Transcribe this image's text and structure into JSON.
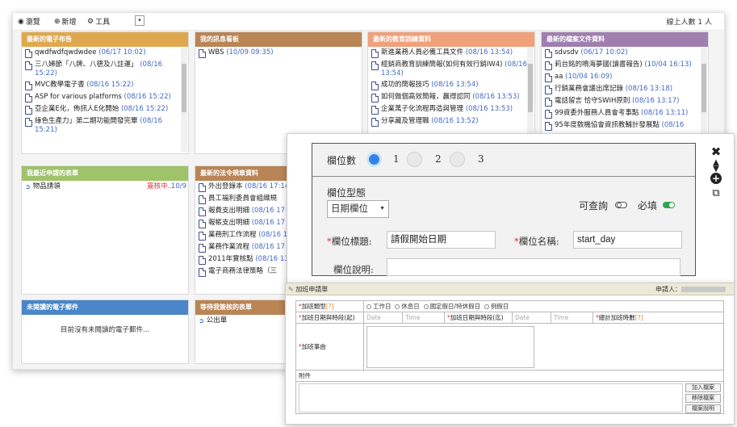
{
  "toolbar": {
    "overview": "瀏覽",
    "add": "新增",
    "tools": "工具",
    "dropdown": "▾",
    "online": "線上人數 1 人"
  },
  "panels": {
    "announcements": {
      "title": "最新的電子布告",
      "color": "#e0a84e",
      "items": [
        {
          "text": "qwdfwdfqwdwdee",
          "date": "(06/17 10:02)"
        },
        {
          "text": "三八婦節「八牌、八德及八註運」",
          "date": "(08/16 15:22)"
        },
        {
          "text": "MVC教學電子書",
          "date": "(08/16 15:22)"
        },
        {
          "text": "ASP for various platforms",
          "date": "(08/16 15:22)"
        },
        {
          "text": "亞企業E化，佈訊人E化開始",
          "date": "(08/16 15:22)"
        },
        {
          "text": "綠色生產力」第二期功能開發完畢",
          "date": "(08/16 15:21)"
        }
      ]
    },
    "messages": {
      "title": "我的訊息看板",
      "color": "#b98555",
      "items": [
        {
          "text": "WBS",
          "date": "(10/09 09:35)"
        }
      ]
    },
    "training": {
      "title": "最新的教育訓練資料",
      "color": "#f0a07a",
      "items": [
        {
          "text": "新進業務人員必備工具文件",
          "date": "(08/16 13:54)"
        },
        {
          "text": "經銷商教育訓練簡報(如何有效行銷IW4)",
          "date": "(08/16 13:54)"
        },
        {
          "text": "成功的簡報技巧",
          "date": "(08/16 13:54)"
        },
        {
          "text": "如何做個高效簡報，贏得認同",
          "date": "(08/16 13:53)"
        },
        {
          "text": "企業萬子化流程再造與管理",
          "date": "(08/16 13:53)"
        },
        {
          "text": "分享藏及管理職",
          "date": "(08/16 13:52)"
        }
      ]
    },
    "files": {
      "title": "最新的檔案文件資料",
      "color": "#a07fb0",
      "items": [
        {
          "text": "sdvsdv",
          "date": "(06/17 10:02)"
        },
        {
          "text": "莉台銘的鳴海夢國(讀書報告)",
          "date": "(10/04 16:13)"
        },
        {
          "text": "aa",
          "date": "(10/04 16:09)"
        },
        {
          "text": "行銷業務會議出席記錄",
          "date": "(08/16 13:18)"
        },
        {
          "text": "電話留言 恰守SWIH原則",
          "date": "(08/16 13:17)"
        },
        {
          "text": "99資委外服務人員會考事點",
          "date": "(08/16 13:11)"
        },
        {
          "text": "95年度敎機協會資訊教輔計發展點",
          "date": "(08/16"
        }
      ]
    },
    "requests": {
      "title": "我最近申請的表單",
      "color": "#9fc36a",
      "items": [
        {
          "text": "物品請領",
          "status": "簽核中..",
          "date": "10/9"
        }
      ]
    },
    "regulations": {
      "title": "最新的法令規章資料",
      "color": "#b98555",
      "items": [
        {
          "text": "外出登錄本",
          "date": "(08/16 17:14)"
        },
        {
          "text": "員工福利委員會組織規",
          "date": ""
        },
        {
          "text": "報費支出明細",
          "date": "(08/16 17"
        },
        {
          "text": "報帳支出明細",
          "date": "(08/16 17"
        },
        {
          "text": "業務刑工作流程",
          "date": "(08/16 17"
        },
        {
          "text": "業務作業流程",
          "date": "(08/16 17"
        },
        {
          "text": "2011年實核點",
          "date": "(08/16 13:2"
        },
        {
          "text": "電子商務法律策略（三",
          "date": ""
        }
      ]
    },
    "unread": {
      "title": "未閱讀的電子郵件",
      "color": "#4a86c8",
      "message": "目前沒有未閱讀的電子郵件..."
    },
    "pending": {
      "title": "等待我簽核的表單",
      "color": "#b98555",
      "items": [
        {
          "text": "公出單"
        }
      ]
    }
  },
  "editor": {
    "column_count_label": "欄位數",
    "options": [
      "1",
      "2",
      "3"
    ],
    "selected_option": "",
    "type_label": "欄位型態",
    "type_value": "日期欄位",
    "queryable_label": "可查詢",
    "required_label": "必填",
    "title_label": "欄位標題:",
    "title_value": "請假開始日期",
    "name_label": "欄位名稱:",
    "name_value": "start_day",
    "desc_label": "欄位說明:",
    "desc_value": "",
    "toggle_on_color": "#2ba84a",
    "radio_color": "#2f86e8"
  },
  "form": {
    "title": "加班申請單",
    "applicant_label": "申請人：",
    "type_label": "加班類型",
    "type_hint": "[?]",
    "type_options": [
      "工作日",
      "休息日",
      "國定假日/特休假日",
      "例假日"
    ],
    "start_label": "加班日期與時段(起)",
    "end_label": "加班日期與時段(迄)",
    "date_placeholder": "Date",
    "time_placeholder": "Time",
    "total_label": "總計加班時數",
    "total_hint": "[?]",
    "reason_label": "加班事由",
    "attachment_label": "附件",
    "add_file": "加入檔案",
    "remove_file": "移除檔案",
    "file_note": "檔案說明"
  }
}
